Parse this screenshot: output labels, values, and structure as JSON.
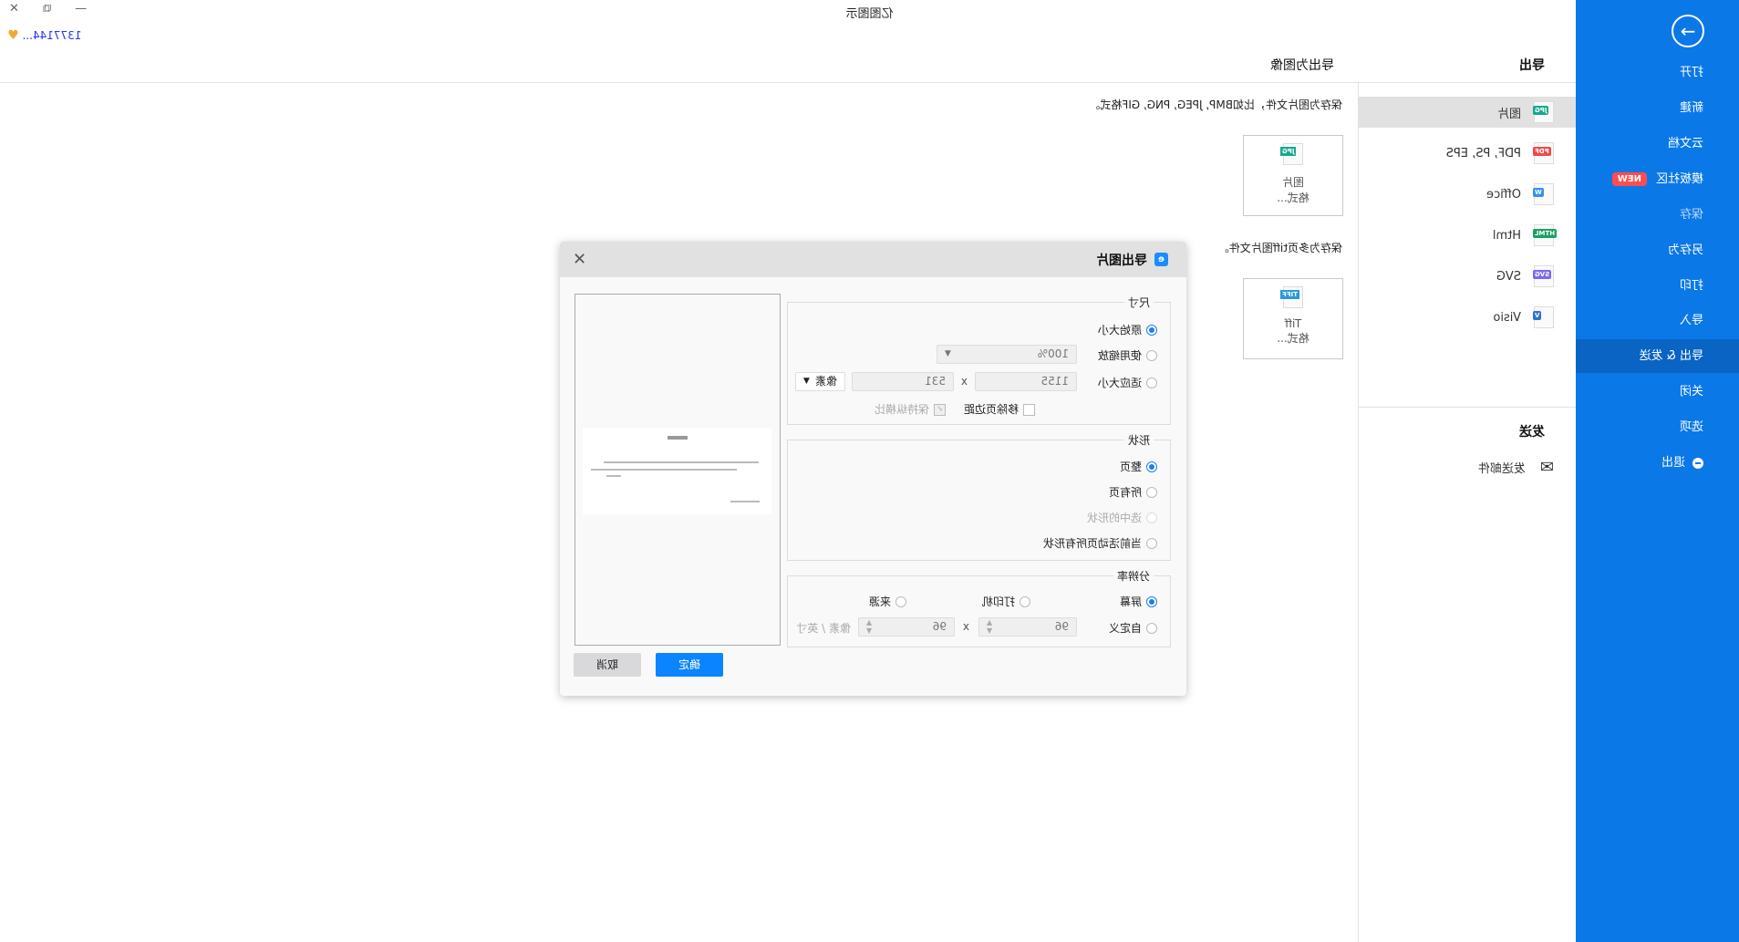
{
  "window": {
    "title": "亿图图示",
    "user": "1377144...",
    "controls": [
      "close",
      "restore",
      "minimize"
    ]
  },
  "sidebar": {
    "items": [
      {
        "label": "打开"
      },
      {
        "label": "新建"
      },
      {
        "label": "云文档"
      },
      {
        "label": "模板社区",
        "badge": "NEW"
      },
      {
        "label": "保存"
      },
      {
        "label": "另存为"
      },
      {
        "label": "打印"
      },
      {
        "label": "导入"
      },
      {
        "label": "导出 & 发送",
        "active": true
      },
      {
        "label": "关闭"
      },
      {
        "label": "选项"
      },
      {
        "label": "退出"
      }
    ]
  },
  "export_panel": {
    "title": "导出",
    "items": [
      {
        "label": "图片",
        "badge": "JPG",
        "color": "#17a88f"
      },
      {
        "label": "PDF, PS, EPS",
        "badge": "PDF",
        "color": "#f04848"
      },
      {
        "label": "Office",
        "badge": "W",
        "color": "#3b8fea"
      },
      {
        "label": "Html",
        "badge": "HTML",
        "color": "#1aa260"
      },
      {
        "label": "SVG",
        "badge": "SVG",
        "color": "#7b68ee"
      },
      {
        "label": "Visio",
        "badge": "V",
        "color": "#2f6fd8"
      }
    ],
    "send_title": "发送",
    "send_item": "发送邮件"
  },
  "main": {
    "title": "导出为图像",
    "desc1": "保存为图片文件，比如BMP, JPEG, PNG, GIF格式。",
    "card1": {
      "badge": "JPG",
      "line1": "图片",
      "line2": "格式..."
    },
    "desc2": "保存为多页tiff图片文件。",
    "card2": {
      "badge": "TIFF",
      "line1": "Tiff",
      "line2": "格式..."
    }
  },
  "dialog": {
    "title": "导出图片",
    "size": {
      "label": "尺寸",
      "original": "原始大小",
      "zoom": "使用缩放",
      "zoom_value": "100%",
      "fit": "适应大小",
      "width": "1155",
      "x": "x",
      "height": "531",
      "unit": "像素",
      "remove_margin": "移除页边距",
      "keep_ratio": "保持纵横比"
    },
    "shape": {
      "label": "形状",
      "whole": "整页",
      "all": "所有页",
      "selected": "选中的形状",
      "current": "当前活动页所有形状"
    },
    "resolution": {
      "label": "分辨率",
      "screen": "屏幕",
      "printer": "打印机",
      "source": "来源",
      "custom": "自定义",
      "dpi_x": "96",
      "x": "x",
      "dpi_y": "96",
      "unit": "像素 / 英寸"
    },
    "ok": "确定",
    "cancel": "取消"
  }
}
